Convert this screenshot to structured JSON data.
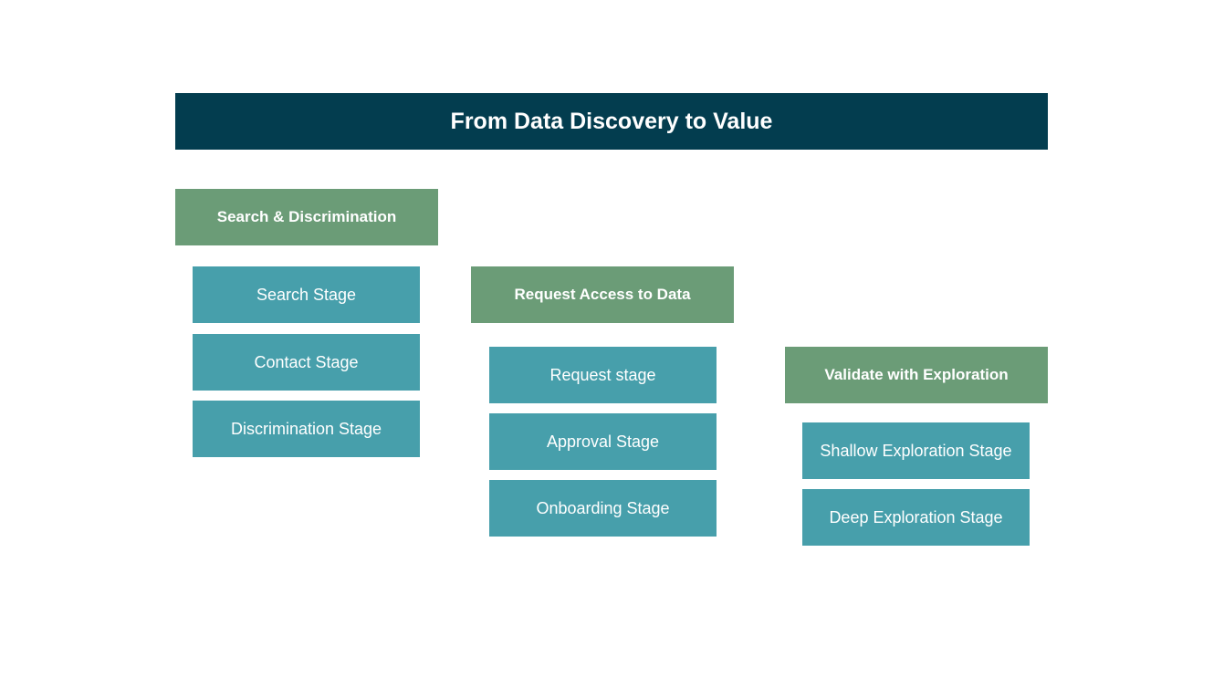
{
  "title": "From Data Discovery to Value",
  "colors": {
    "title_bg": "#033d4f",
    "phase_bg": "#6b9c77",
    "stage_bg": "#479fab",
    "text": "#ffffff"
  },
  "phases": [
    {
      "label": "Search & Discrimination",
      "stages": [
        "Search Stage",
        "Contact Stage",
        "Discrimination Stage"
      ]
    },
    {
      "label": "Request Access to Data",
      "stages": [
        "Request stage",
        "Approval Stage",
        "Onboarding Stage"
      ]
    },
    {
      "label": "Validate with Exploration",
      "stages": [
        "Shallow Exploration Stage",
        "Deep Exploration Stage"
      ]
    }
  ]
}
